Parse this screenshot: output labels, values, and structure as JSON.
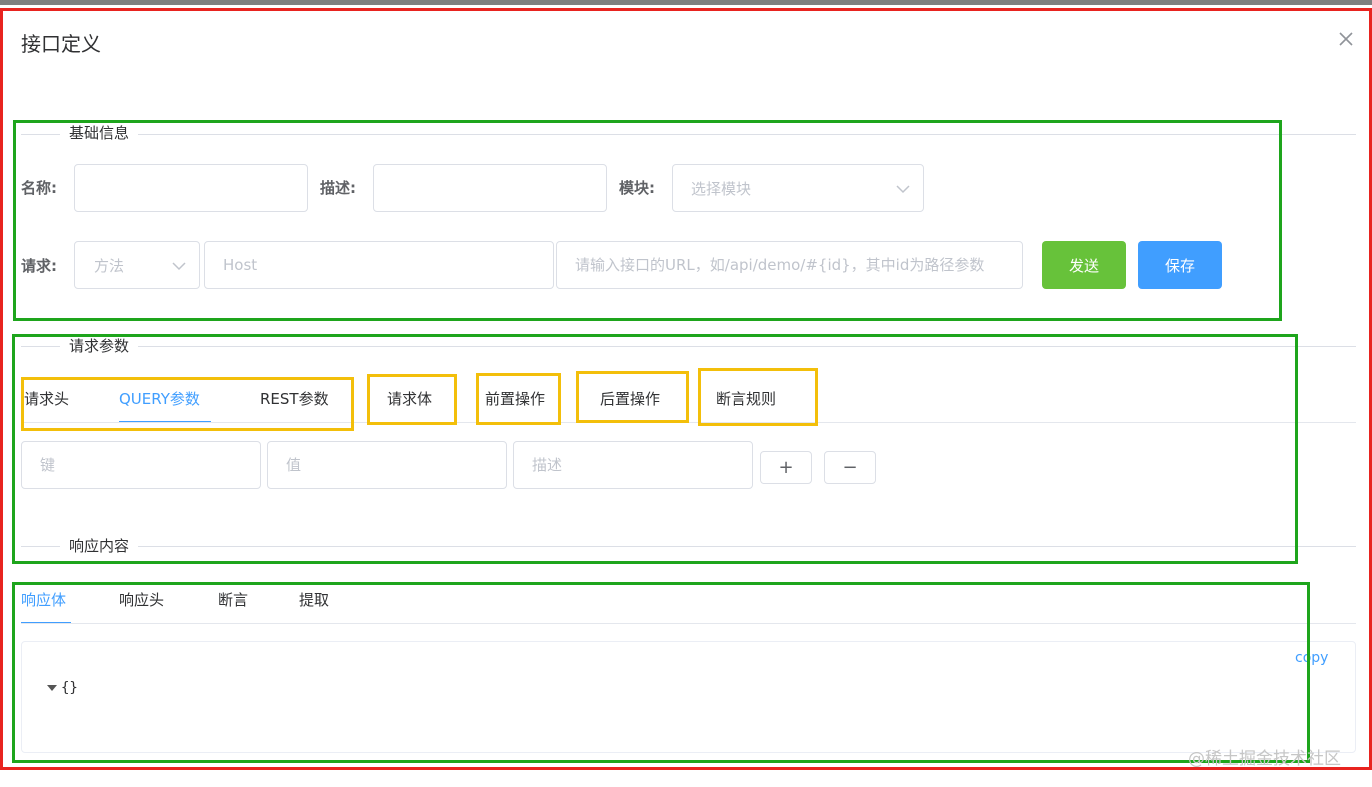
{
  "dialog": {
    "title": "接口定义",
    "close_icon": "close-icon"
  },
  "sections": {
    "basic": "基础信息",
    "params": "请求参数",
    "response": "响应内容"
  },
  "basic_form": {
    "name_label": "名称:",
    "name_value": "",
    "desc_label": "描述:",
    "desc_value": "",
    "module_label": "模块:",
    "module_placeholder": "选择模块",
    "request_label": "请求:",
    "method_placeholder": "方法",
    "host_placeholder": "Host",
    "url_placeholder": "请输入接口的URL，如/api/demo/#{id}，其中id为路径参数",
    "send_label": "发送",
    "save_label": "保存"
  },
  "request_tabs": {
    "items": [
      "请求头",
      "QUERY参数",
      "REST参数",
      "请求体",
      "前置操作",
      "后置操作",
      "断言规则"
    ],
    "active": "QUERY参数"
  },
  "query_row": {
    "key_placeholder": "键",
    "value_placeholder": "值",
    "desc_placeholder": "描述",
    "add_label": "+",
    "remove_label": "−"
  },
  "response_tabs": {
    "items": [
      "响应体",
      "响应头",
      "断言",
      "提取"
    ],
    "active": "响应体"
  },
  "response_body": {
    "copy_label": "copy",
    "json_text": "{}"
  },
  "watermark": "@稀土掘金技术社区",
  "colors": {
    "primary": "#409eff",
    "success": "#67c23a",
    "annotation_red": "#e8231f",
    "annotation_green": "#1ea51c",
    "annotation_yellow": "#f3bf0a"
  }
}
